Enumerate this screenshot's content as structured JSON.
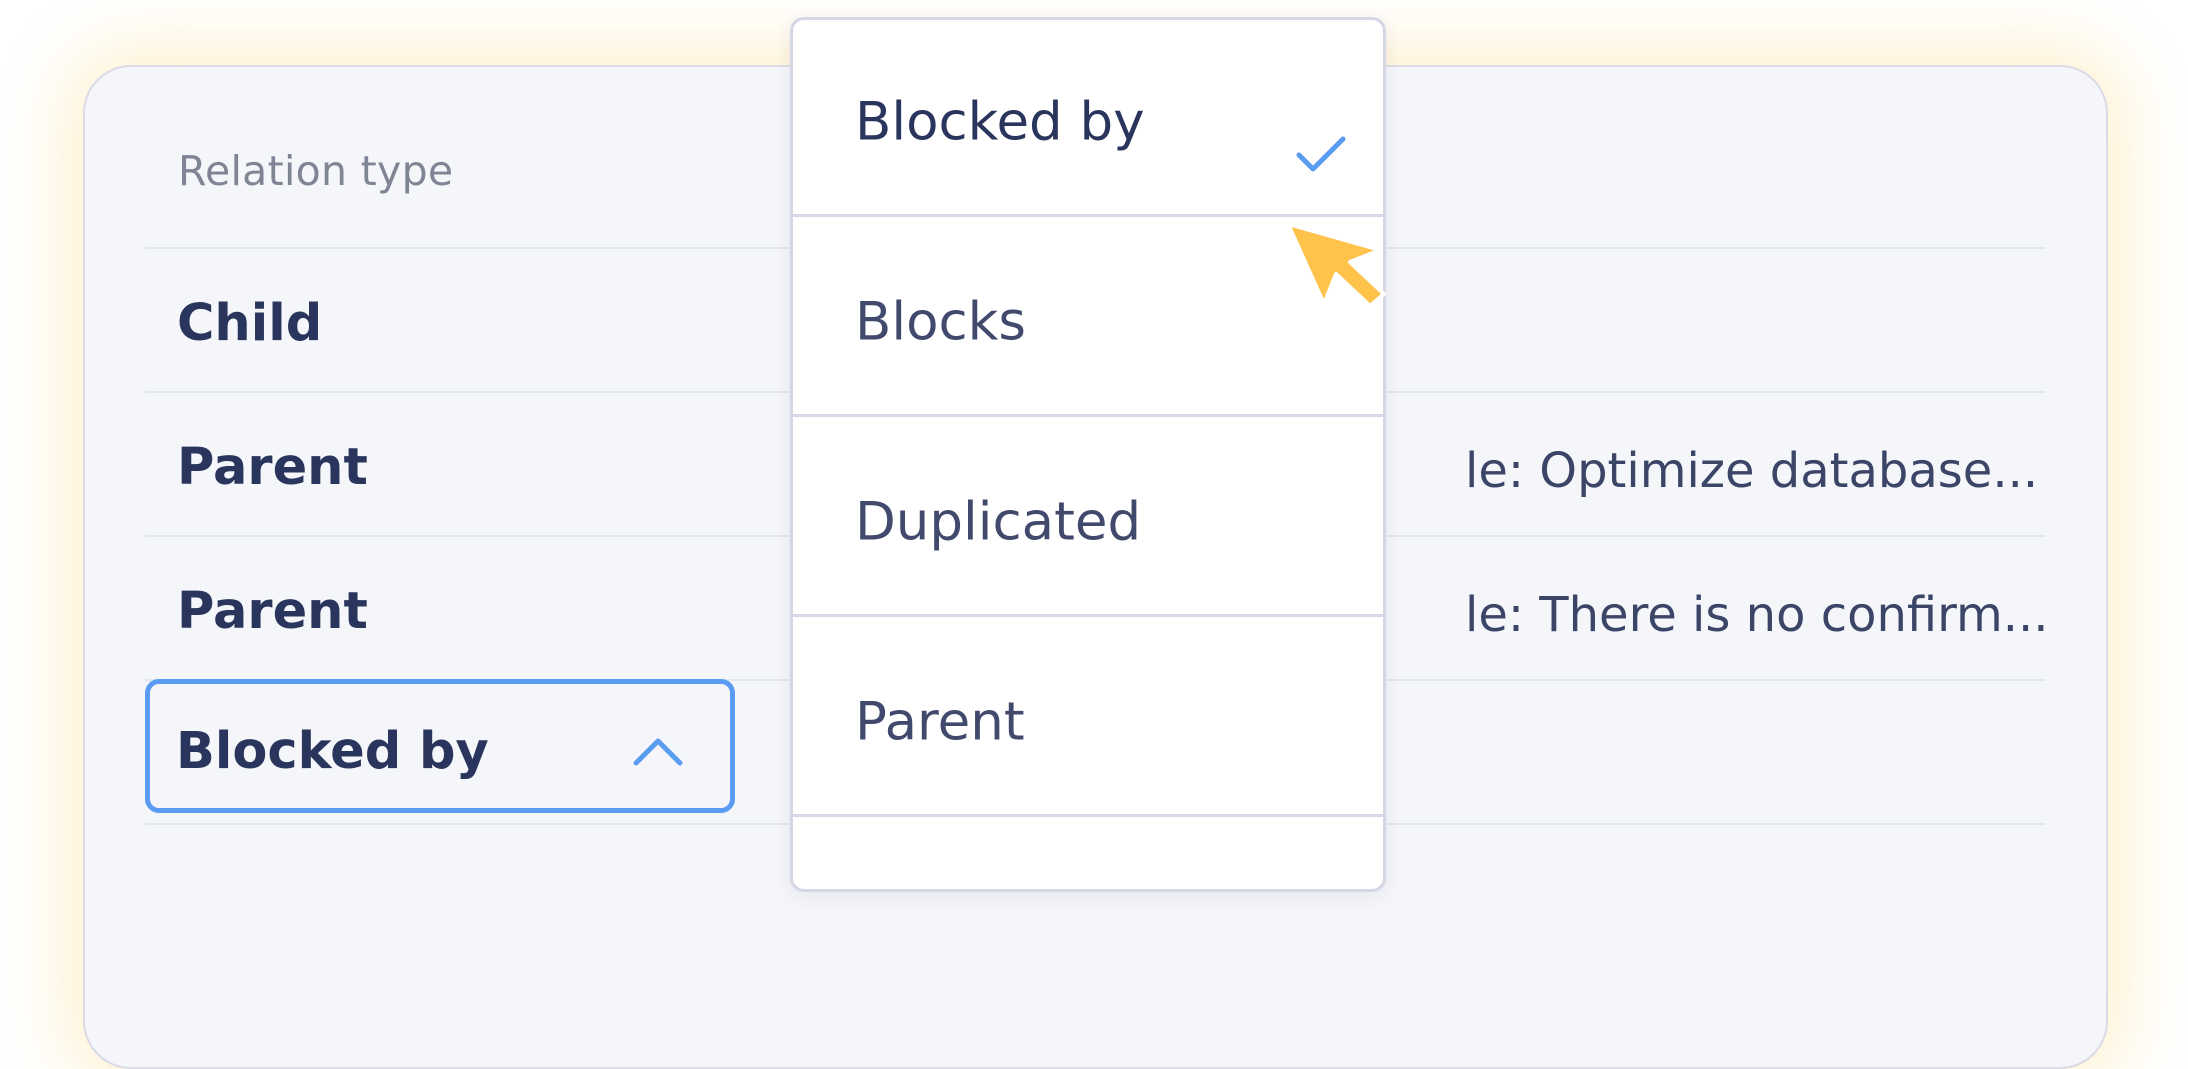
{
  "table": {
    "column_header": "Relation type",
    "rows": [
      {
        "label": "Child"
      },
      {
        "label": "Parent",
        "peek_text": "le: Optimize database..."
      },
      {
        "label": "Parent",
        "peek_text": "le: There is no confirm..."
      }
    ]
  },
  "relation_select": {
    "value": "Blocked by",
    "expanded": true
  },
  "dropdown": {
    "options": [
      {
        "label": "Blocked by",
        "selected": true
      },
      {
        "label": "Blocks",
        "selected": false
      },
      {
        "label": "Duplicated",
        "selected": false
      },
      {
        "label": "Parent",
        "selected": false
      }
    ]
  },
  "icons": {
    "caret": "chevron-up-icon",
    "check": "check-icon",
    "cursor": "mouse-pointer-icon"
  },
  "colors": {
    "accent": "#5a9cf2",
    "cursor": "#ffc24b",
    "text_primary": "#29355c",
    "card_bg": "#f5f6f9"
  }
}
